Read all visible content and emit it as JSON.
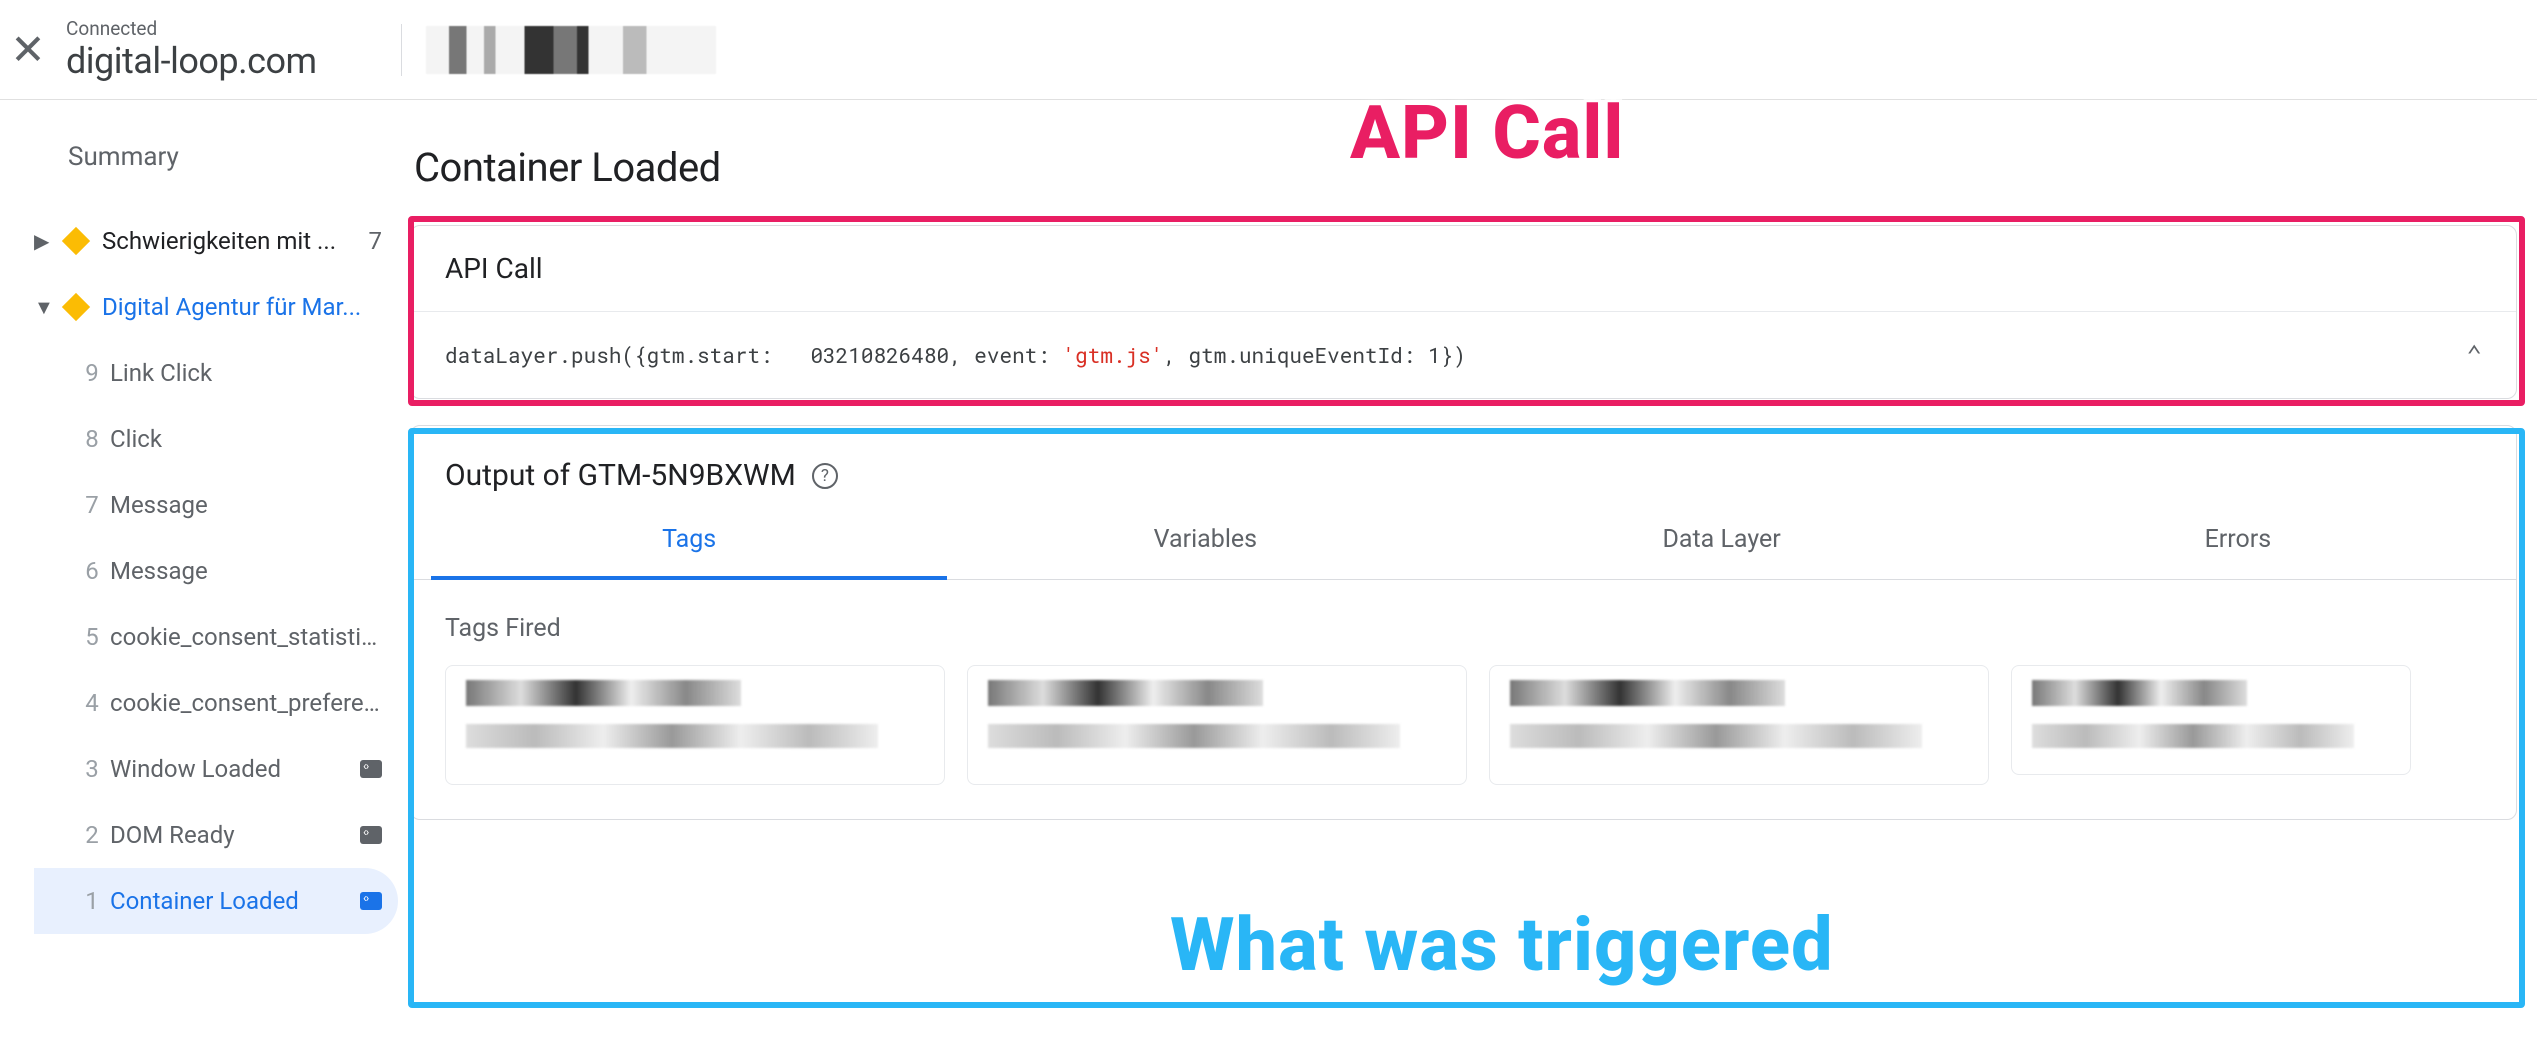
{
  "header": {
    "connected_label": "Connected",
    "domain": "digital-loop.com"
  },
  "sidebar": {
    "summary_label": "Summary",
    "groups": [
      {
        "expanded": false,
        "label": "Schwierigkeiten mit ...",
        "count": "7",
        "active": false
      },
      {
        "expanded": true,
        "label": "Digital Agentur für Mar...",
        "count": "",
        "active": true
      }
    ],
    "events": [
      {
        "num": "9",
        "label": "Link Click",
        "chip": false,
        "selected": false
      },
      {
        "num": "8",
        "label": "Click",
        "chip": false,
        "selected": false
      },
      {
        "num": "7",
        "label": "Message",
        "chip": false,
        "selected": false
      },
      {
        "num": "6",
        "label": "Message",
        "chip": false,
        "selected": false
      },
      {
        "num": "5",
        "label": "cookie_consent_statistics",
        "chip": false,
        "selected": false
      },
      {
        "num": "4",
        "label": "cookie_consent_prefere...",
        "chip": false,
        "selected": false
      },
      {
        "num": "3",
        "label": "Window Loaded",
        "chip": true,
        "selected": false
      },
      {
        "num": "2",
        "label": "DOM Ready",
        "chip": true,
        "selected": false
      },
      {
        "num": "1",
        "label": "Container Loaded",
        "chip": true,
        "selected": true
      }
    ]
  },
  "main": {
    "title": "Container Loaded",
    "api_card": {
      "title": "API Call",
      "code_pre": "dataLayer.push({gtm.start:   03210826480, event: ",
      "code_str": "'gtm.js'",
      "code_post": ", gtm.uniqueEventId: 1})"
    },
    "output_card": {
      "title": "Output of GTM-5N9BXWM",
      "tabs": [
        "Tags",
        "Variables",
        "Data Layer",
        "Errors"
      ],
      "active_tab": 0,
      "section_label": "Tags Fired"
    }
  },
  "annotations": {
    "red_label": "API Call",
    "blue_label": "What was triggered"
  }
}
